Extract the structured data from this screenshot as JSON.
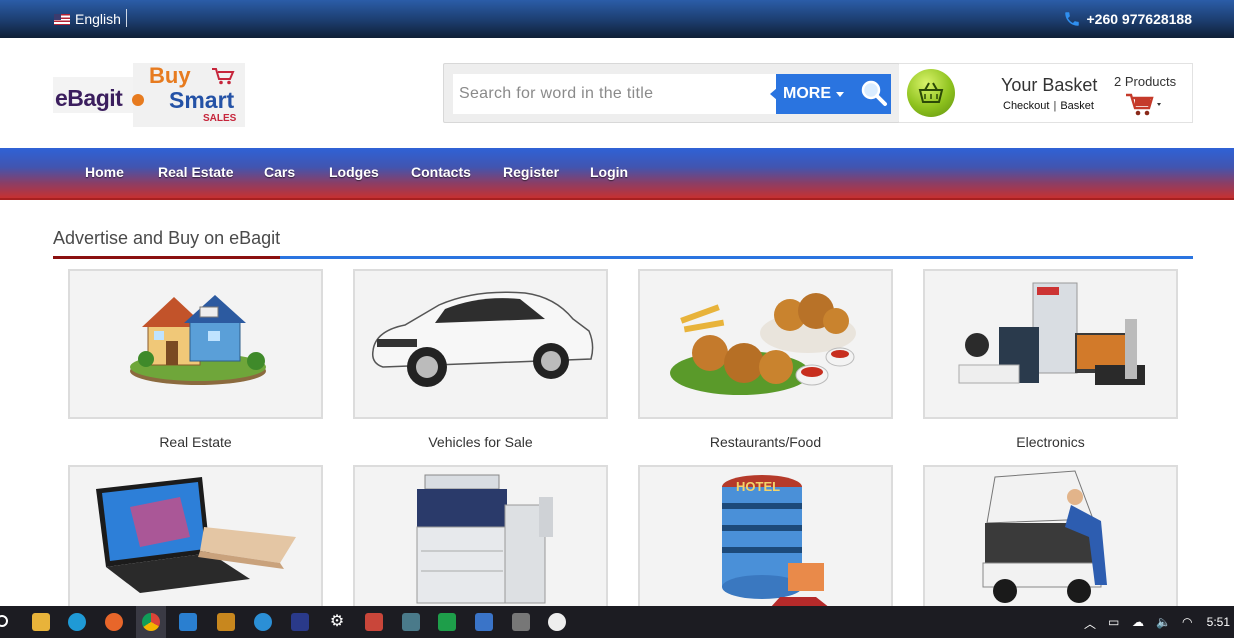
{
  "topbar": {
    "language": "English",
    "phone": "+260 977628188"
  },
  "logo": {
    "brand": "eBagit",
    "buy": "Buy",
    "smart": "Smart",
    "sales": "SALES"
  },
  "search": {
    "placeholder": "Search for word in the title",
    "more_label": "MORE"
  },
  "basket": {
    "title": "Your Basket",
    "checkout": "Checkout",
    "basket_link": "Basket",
    "products": "2 Products"
  },
  "nav": {
    "items": [
      "Home",
      "Real Estate",
      "Cars",
      "Lodges",
      "Contacts",
      "Register",
      "Login"
    ]
  },
  "section": {
    "title": "Advertise and Buy on eBagit"
  },
  "categories": [
    {
      "label": "Real Estate",
      "icon": "house-icon"
    },
    {
      "label": "Vehicles for Sale",
      "icon": "car-icon"
    },
    {
      "label": "Restaurants/Food",
      "icon": "food-icon"
    },
    {
      "label": "Electronics",
      "icon": "electronics-icon"
    },
    {
      "label": "",
      "icon": "laptop-icon"
    },
    {
      "label": "",
      "icon": "copier-icon"
    },
    {
      "label": "",
      "icon": "hotel-icon"
    },
    {
      "label": "",
      "icon": "mechanic-icon"
    }
  ],
  "taskbar": {
    "time": "5:51"
  },
  "colors": {
    "accent_blue": "#2a74e0",
    "accent_red": "#8b1010",
    "nav_top": "#2f62d6",
    "nav_bottom": "#c63131"
  }
}
